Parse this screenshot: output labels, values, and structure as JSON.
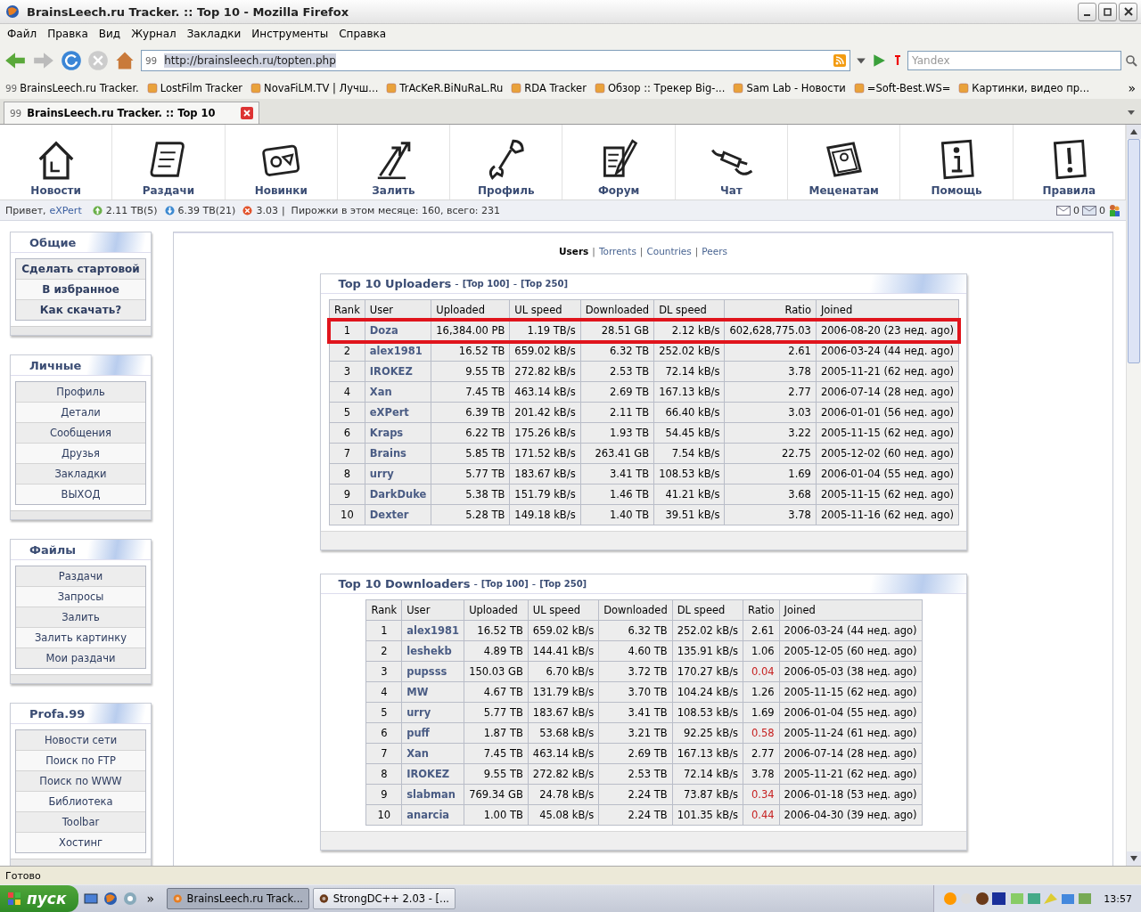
{
  "window": {
    "title": "BrainsLeech.ru Tracker. :: Top 10 - Mozilla Firefox"
  },
  "menu": [
    "Файл",
    "Правка",
    "Вид",
    "Журнал",
    "Закладки",
    "Инструменты",
    "Справка"
  ],
  "address_bar": {
    "favicon": "99",
    "url": "http://brainsleech.ru/topten.php"
  },
  "search": {
    "placeholder": "Yandex"
  },
  "bookmarks": [
    {
      "label": "BrainsLeech.ru Tracker.",
      "favicon": "99"
    },
    {
      "label": "LostFilm Tracker"
    },
    {
      "label": "NovaFiLM.TV | Лучш..."
    },
    {
      "label": "TrAcKeR.BiNuRaL.Ru"
    },
    {
      "label": "RDA Tracker"
    },
    {
      "label": "Обзор :: Трекер Big-..."
    },
    {
      "label": "Sam Lab - Новости"
    },
    {
      "label": "=Soft-Best.WS="
    },
    {
      "label": "Картинки, видео пр..."
    }
  ],
  "bookmarks_more": "»",
  "tabs": [
    {
      "label": "BrainsLeech.ru Tracker. :: Top 10",
      "favicon": "99",
      "selected": true
    }
  ],
  "site_nav": [
    {
      "label": "Новости"
    },
    {
      "label": "Раздачи"
    },
    {
      "label": "Новинки"
    },
    {
      "label": "Залить"
    },
    {
      "label": "Профиль"
    },
    {
      "label": "Форум"
    },
    {
      "label": "Чат"
    },
    {
      "label": "Меценатам"
    },
    {
      "label": "Помощь"
    },
    {
      "label": "Правила"
    }
  ],
  "user_bar": {
    "greeting": "Привет,",
    "user": "eXPert",
    "uploaded": "2.11 TB(5)",
    "downloaded": "6.39 TB(21)",
    "ratio": "3.03",
    "pies": "|  Пирожки в этом месяце: 160, всего: 231",
    "inbox": "0",
    "outbox": "0"
  },
  "sidebar": [
    {
      "title": "Общие",
      "emphasized": true,
      "items": [
        "Сделать стартовой",
        "В избранное",
        "Как скачать?"
      ]
    },
    {
      "title": "Личные",
      "emphasized": false,
      "items": [
        "Профиль",
        "Детали",
        "Сообщения",
        "Друзья",
        "Закладки",
        "ВЫХОД"
      ]
    },
    {
      "title": "Файлы",
      "emphasized": false,
      "items": [
        "Раздачи",
        "Запросы",
        "Залить",
        "Залить картинку",
        "Мои раздачи"
      ]
    },
    {
      "title": "Profa.99",
      "emphasized": false,
      "items": [
        "Новости сети",
        "Поиск по FTP",
        "Поиск по WWW",
        "Библиотека",
        "Toolbar",
        "Хостинг"
      ]
    }
  ],
  "stats_separator": "|",
  "stats_tabs": [
    {
      "label": "Users",
      "selected": true
    },
    {
      "label": "Torrents",
      "selected": false
    },
    {
      "label": "Countries",
      "selected": false
    },
    {
      "label": "Peers",
      "selected": false
    }
  ],
  "tables": [
    {
      "title": "Top 10 Uploaders",
      "separator": "-",
      "links": [
        "[Top 100]",
        "[Top 250]"
      ],
      "columns": [
        "Rank",
        "User",
        "Uploaded",
        "UL speed",
        "Downloaded",
        "DL speed",
        "Ratio",
        "Joined"
      ],
      "rows": [
        {
          "cells": [
            "1",
            "Doza",
            "16,384.00 PB",
            "1.19 TB/s",
            "28.51 GB",
            "2.12 kB/s",
            "602,628,775.03",
            "2006-08-20 (23 нед. ago)"
          ],
          "highlighted": true,
          "low_ratio": false
        },
        {
          "cells": [
            "2",
            "alex1981",
            "16.52 TB",
            "659.02 kB/s",
            "6.32 TB",
            "252.02 kB/s",
            "2.61",
            "2006-03-24 (44 нед. ago)"
          ],
          "highlighted": false,
          "low_ratio": false
        },
        {
          "cells": [
            "3",
            "IROKEZ",
            "9.55 TB",
            "272.82 kB/s",
            "2.53 TB",
            "72.14 kB/s",
            "3.78",
            "2005-11-21 (62 нед. ago)"
          ],
          "highlighted": false,
          "low_ratio": false
        },
        {
          "cells": [
            "4",
            "Xan",
            "7.45 TB",
            "463.14 kB/s",
            "2.69 TB",
            "167.13 kB/s",
            "2.77",
            "2006-07-14 (28 нед. ago)"
          ],
          "highlighted": false,
          "low_ratio": false
        },
        {
          "cells": [
            "5",
            "eXPert",
            "6.39 TB",
            "201.42 kB/s",
            "2.11 TB",
            "66.40 kB/s",
            "3.03",
            "2006-01-01 (56 нед. ago)"
          ],
          "highlighted": false,
          "low_ratio": false
        },
        {
          "cells": [
            "6",
            "Kraps",
            "6.22 TB",
            "175.26 kB/s",
            "1.93 TB",
            "54.45 kB/s",
            "3.22",
            "2005-11-15 (62 нед. ago)"
          ],
          "highlighted": false,
          "low_ratio": false
        },
        {
          "cells": [
            "7",
            "Brains",
            "5.85 TB",
            "171.52 kB/s",
            "263.41 GB",
            "7.54 kB/s",
            "22.75",
            "2005-12-02 (60 нед. ago)"
          ],
          "highlighted": false,
          "low_ratio": false
        },
        {
          "cells": [
            "8",
            "urry",
            "5.77 TB",
            "183.67 kB/s",
            "3.41 TB",
            "108.53 kB/s",
            "1.69",
            "2006-01-04 (55 нед. ago)"
          ],
          "highlighted": false,
          "low_ratio": false
        },
        {
          "cells": [
            "9",
            "DarkDuke",
            "5.38 TB",
            "151.79 kB/s",
            "1.46 TB",
            "41.21 kB/s",
            "3.68",
            "2005-11-15 (62 нед. ago)"
          ],
          "highlighted": false,
          "low_ratio": false
        },
        {
          "cells": [
            "10",
            "Dexter",
            "5.28 TB",
            "149.18 kB/s",
            "1.40 TB",
            "39.51 kB/s",
            "3.78",
            "2005-11-16 (62 нед. ago)"
          ],
          "highlighted": false,
          "low_ratio": false
        }
      ]
    },
    {
      "title": "Top 10 Downloaders",
      "separator": "-",
      "links": [
        "[Top 100]",
        "[Top 250]"
      ],
      "columns": [
        "Rank",
        "User",
        "Uploaded",
        "UL speed",
        "Downloaded",
        "DL speed",
        "Ratio",
        "Joined"
      ],
      "rows": [
        {
          "cells": [
            "1",
            "alex1981",
            "16.52 TB",
            "659.02 kB/s",
            "6.32 TB",
            "252.02 kB/s",
            "2.61",
            "2006-03-24 (44 нед. ago)"
          ],
          "highlighted": false,
          "low_ratio": false
        },
        {
          "cells": [
            "2",
            "leshekb",
            "4.89 TB",
            "144.41 kB/s",
            "4.60 TB",
            "135.91 kB/s",
            "1.06",
            "2005-12-05 (60 нед. ago)"
          ],
          "highlighted": false,
          "low_ratio": false
        },
        {
          "cells": [
            "3",
            "pupsss",
            "150.03 GB",
            "6.70 kB/s",
            "3.72 TB",
            "170.27 kB/s",
            "0.04",
            "2006-05-03 (38 нед. ago)"
          ],
          "highlighted": false,
          "low_ratio": true
        },
        {
          "cells": [
            "4",
            "MW",
            "4.67 TB",
            "131.79 kB/s",
            "3.70 TB",
            "104.24 kB/s",
            "1.26",
            "2005-11-15 (62 нед. ago)"
          ],
          "highlighted": false,
          "low_ratio": false
        },
        {
          "cells": [
            "5",
            "urry",
            "5.77 TB",
            "183.67 kB/s",
            "3.41 TB",
            "108.53 kB/s",
            "1.69",
            "2006-01-04 (55 нед. ago)"
          ],
          "highlighted": false,
          "low_ratio": false
        },
        {
          "cells": [
            "6",
            "puff",
            "1.87 TB",
            "53.68 kB/s",
            "3.21 TB",
            "92.25 kB/s",
            "0.58",
            "2005-11-24 (61 нед. ago)"
          ],
          "highlighted": false,
          "low_ratio": true
        },
        {
          "cells": [
            "7",
            "Xan",
            "7.45 TB",
            "463.14 kB/s",
            "2.69 TB",
            "167.13 kB/s",
            "2.77",
            "2006-07-14 (28 нед. ago)"
          ],
          "highlighted": false,
          "low_ratio": false
        },
        {
          "cells": [
            "8",
            "IROKEZ",
            "9.55 TB",
            "272.82 kB/s",
            "2.53 TB",
            "72.14 kB/s",
            "3.78",
            "2005-11-21 (62 нед. ago)"
          ],
          "highlighted": false,
          "low_ratio": false
        },
        {
          "cells": [
            "9",
            "slabman",
            "769.34 GB",
            "24.78 kB/s",
            "2.24 TB",
            "73.87 kB/s",
            "0.34",
            "2006-01-18 (53 нед. ago)"
          ],
          "highlighted": false,
          "low_ratio": true
        },
        {
          "cells": [
            "10",
            "anarcia",
            "1.00 TB",
            "45.08 kB/s",
            "2.24 TB",
            "101.35 kB/s",
            "0.44",
            "2006-04-30 (39 нед. ago)"
          ],
          "highlighted": false,
          "low_ratio": true
        }
      ]
    }
  ],
  "status_bar": {
    "text": "Готово"
  },
  "taskbar": {
    "start": "пуск",
    "more": "»",
    "tasks": [
      {
        "label": "BrainsLeech.ru Track...",
        "selected": true
      },
      {
        "label": "StrongDC++ 2.03 - [...",
        "selected": false
      }
    ],
    "clock": "13:57"
  }
}
